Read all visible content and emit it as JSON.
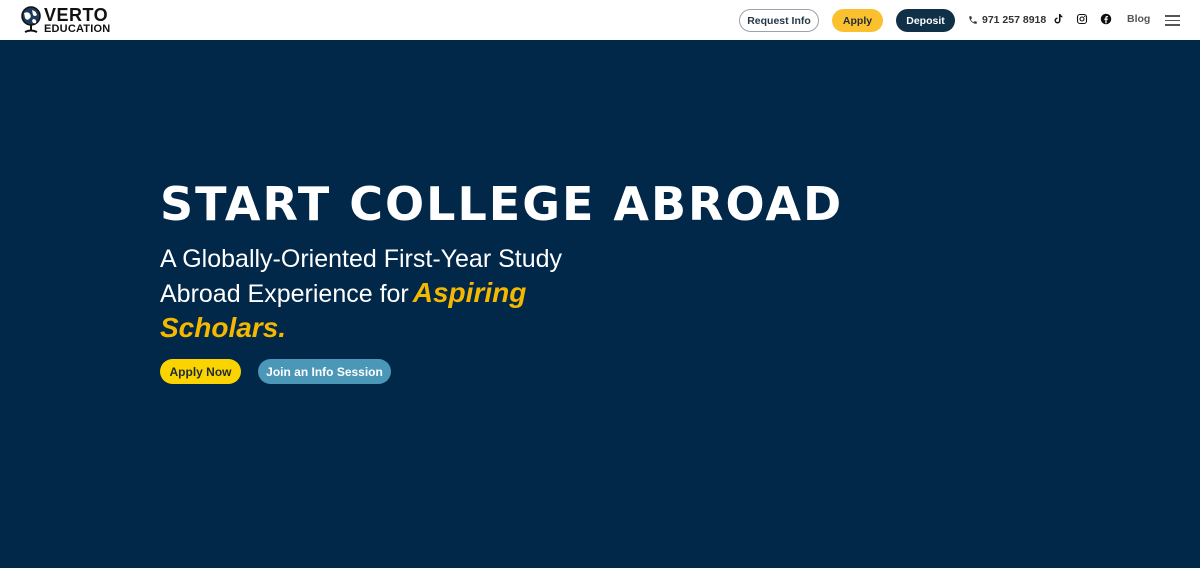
{
  "header": {
    "logo": {
      "top_text": "VERTO",
      "bottom_text": "EDUCATION",
      "icon": "globe-icon"
    },
    "buttons": {
      "request_info": "Request Info",
      "apply": "Apply",
      "deposit": "Deposit"
    },
    "phone": {
      "icon": "phone-icon",
      "number": "971 257 8918"
    },
    "social": [
      "tiktok-icon",
      "instagram-icon",
      "facebook-icon"
    ],
    "blog": "Blog",
    "menu_icon": "hamburger-menu-icon"
  },
  "hero": {
    "title": "START COLLEGE ABROAD",
    "subtitle_line1": "A Globally-Oriented First-Year Study",
    "subtitle_line2": "Abroad Experience for",
    "subtitle_accent": "Aspiring",
    "subtitle_line3": "Scholars.",
    "cta_primary": "Apply Now",
    "cta_secondary": "Join an Info Session"
  },
  "colors": {
    "hero_background": "#012749",
    "accent_yellow": "#fbc02d",
    "deposit_navy": "#0f3047",
    "info_session_blue": "#4b97b7"
  }
}
